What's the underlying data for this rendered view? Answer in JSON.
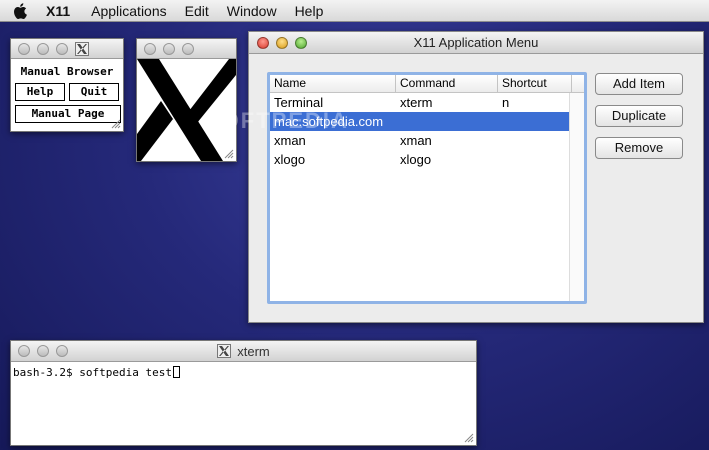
{
  "menubar": {
    "items": [
      "X11",
      "Applications",
      "Edit",
      "Window",
      "Help"
    ]
  },
  "manual_browser": {
    "title": "Manual Browser",
    "help_label": "Help",
    "quit_label": "Quit",
    "manual_page_label": "Manual Page"
  },
  "app_menu": {
    "title": "X11 Application Menu",
    "columns": [
      "Name",
      "Command",
      "Shortcut"
    ],
    "rows": [
      {
        "name": "Terminal",
        "command": "xterm",
        "shortcut": "n"
      },
      {
        "name": "mac.softpedia.com",
        "command": "",
        "shortcut": ""
      },
      {
        "name": "xman",
        "command": "xman",
        "shortcut": ""
      },
      {
        "name": "xlogo",
        "command": "xlogo",
        "shortcut": ""
      }
    ],
    "selected_row": 1,
    "buttons": {
      "add": "Add Item",
      "duplicate": "Duplicate",
      "remove": "Remove"
    }
  },
  "xterm": {
    "title": "xterm",
    "prompt_line": "bash-3.2$ softpedia test"
  },
  "watermark": "SOFTPEDIA"
}
